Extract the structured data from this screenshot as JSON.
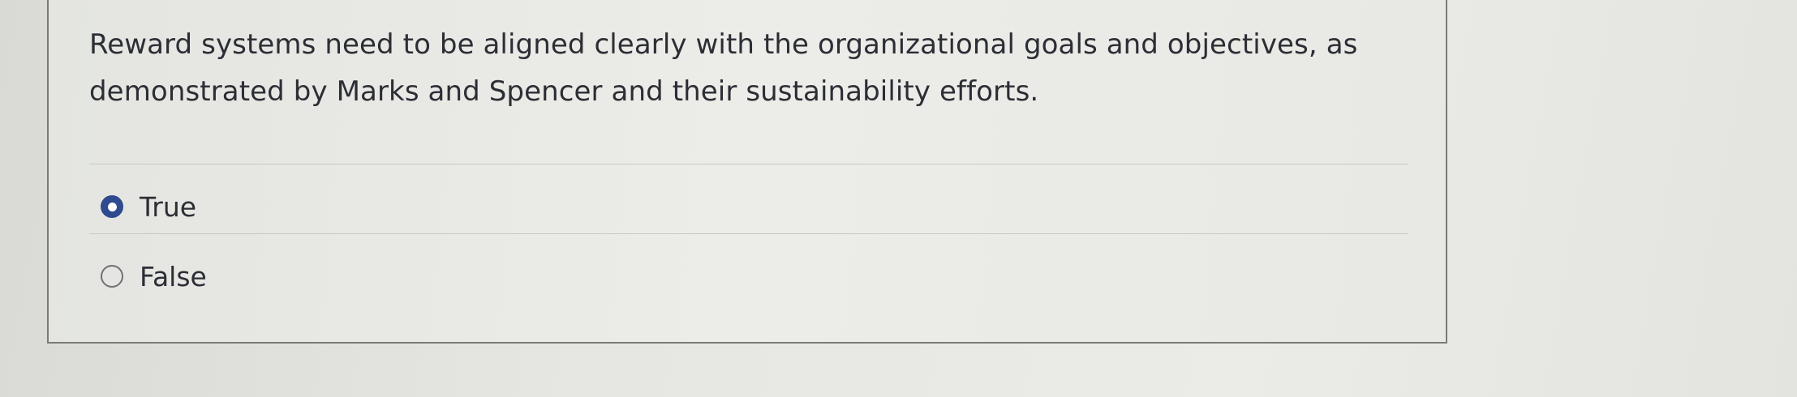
{
  "question": {
    "text": "Reward systems need to be aligned clearly with the organizational goals and objectives, as demonstrated by Marks and Spencer and their sustainability efforts."
  },
  "options": [
    {
      "label": "True",
      "selected": true
    },
    {
      "label": "False",
      "selected": false
    }
  ],
  "colors": {
    "radio_selected": "#2f4a8f",
    "text": "#2c2e35",
    "card_border": "#7a7b78"
  },
  "icons": {
    "selected": "radio-selected-icon",
    "unselected": "radio-unselected-icon"
  }
}
